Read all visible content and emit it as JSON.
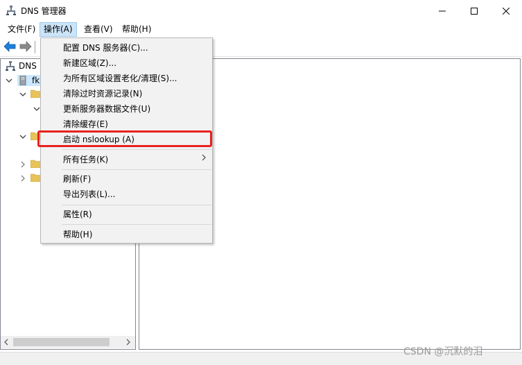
{
  "window": {
    "title": "DNS 管理器"
  },
  "menubar": {
    "items": [
      "文件(F)",
      "操作(A)",
      "查看(V)",
      "帮助(H)"
    ]
  },
  "tree": {
    "root_label": "DNS",
    "server_label": "fk"
  },
  "action_menu": {
    "items": [
      "配置 DNS 服务器(C)...",
      "新建区域(Z)...",
      "为所有区域设置老化/清理(S)...",
      "清除过时资源记录(N)",
      "更新服务器数据文件(U)",
      "清除缓存(E)",
      "启动 nslookup (A)",
      "所有任务(K)",
      "刷新(F)",
      "导出列表(L)...",
      "属性(R)",
      "帮助(H)"
    ]
  },
  "watermark": "CSDN @沉默的泪",
  "colors": {
    "highlight": "#e8211d",
    "menu_active": "#cce4f7",
    "nav_back": "#1e7fd8",
    "folder": "#e8c35a"
  }
}
